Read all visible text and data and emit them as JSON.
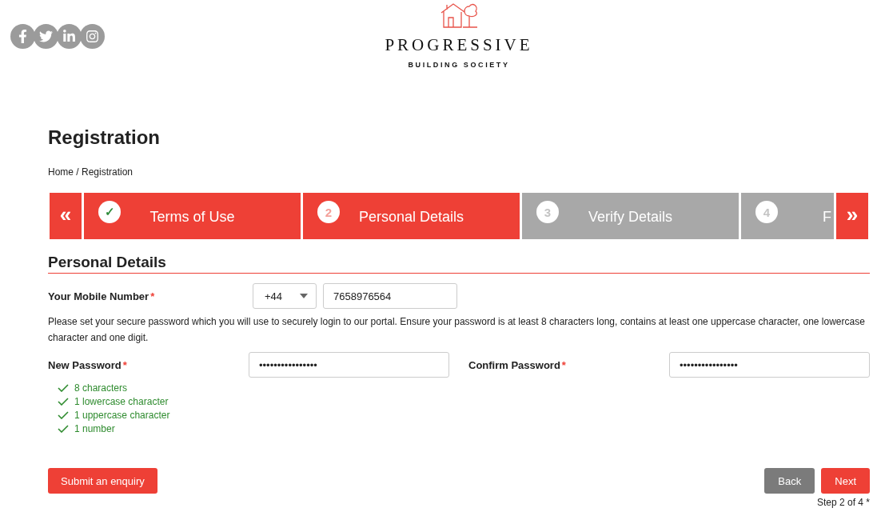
{
  "social": [
    {
      "kind": "facebook"
    },
    {
      "kind": "twitter"
    },
    {
      "kind": "linkedin"
    },
    {
      "kind": "instagram"
    }
  ],
  "logo": {
    "name": "PROGRESSIVE",
    "tagline": "BUILDING SOCIETY"
  },
  "title": "Registration",
  "breadcrumb": "Home / Registration",
  "steps": {
    "prev": "«",
    "next": "»",
    "items": [
      {
        "marker": "✓",
        "kind": "done",
        "label": "Terms of Use"
      },
      {
        "marker": "2",
        "kind": "current",
        "label": "Personal Details"
      },
      {
        "marker": "3",
        "kind": "todo",
        "label": "Verify Details"
      },
      {
        "marker": "4",
        "kind": "todo",
        "label": "F"
      }
    ]
  },
  "section": "Personal Details",
  "mobile": {
    "label": "Your Mobile Number",
    "required": "*",
    "code": "+44",
    "value": "7658976564"
  },
  "instructions": "Please set your secure password which you will use to securely login to our portal. Ensure your password is at least 8 characters long, contains at least one uppercase character, one lowercase character and one digit.",
  "new_password": {
    "label": "New Password",
    "required": "*",
    "value": "••••••••••••••••"
  },
  "confirm_password": {
    "label": "Confirm Password",
    "required": "*",
    "value": "••••••••••••••••"
  },
  "rules": [
    {
      "text": "8 characters",
      "met": true
    },
    {
      "text": "1 lowercase character",
      "met": true
    },
    {
      "text": "1 uppercase character",
      "met": true
    },
    {
      "text": "1 number",
      "met": true
    }
  ],
  "enquiry_button": "Submit an enquiry",
  "back_button": "Back",
  "next_button": "Next",
  "step_note": "Step 2 of 4 *"
}
